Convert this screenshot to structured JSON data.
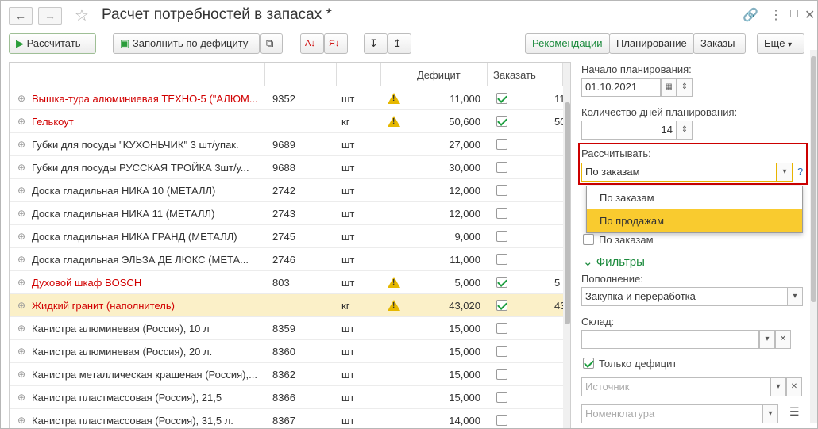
{
  "window": {
    "title": "Расчет потребностей в запасах *"
  },
  "toolbar": {
    "calc": "Рассчитать",
    "fill": "Заполнить по дефициту",
    "rec": "Рекомендации",
    "plan": "Планирование",
    "orders": "Заказы",
    "more": "Еще",
    "more_arrow": "▾"
  },
  "table": {
    "headers": {
      "deficit": "Дефицит",
      "order": "Заказать"
    },
    "rows": [
      {
        "name": "Вышка-тура алюминиевая ТЕХНО-5 (\"АЛЮМ...",
        "code": "9352",
        "unit": "шт",
        "warn": true,
        "deficit": "11,000",
        "checked": true,
        "extra": "11",
        "red": true
      },
      {
        "name": "Гелькоут",
        "code": "",
        "unit": "кг",
        "warn": true,
        "deficit": "50,600",
        "checked": true,
        "extra": "50",
        "red": true
      },
      {
        "name": "Губки для посуды \"КУХОНЬЧИК\" 3 шт/упак.",
        "code": "9689",
        "unit": "шт",
        "warn": false,
        "deficit": "27,000",
        "checked": false,
        "extra": "",
        "red": false
      },
      {
        "name": "Губки для посуды РУССКАЯ ТРОЙКА 3шт/у...",
        "code": "9688",
        "unit": "шт",
        "warn": false,
        "deficit": "30,000",
        "checked": false,
        "extra": "",
        "red": false
      },
      {
        "name": "Доска гладильная  НИКА 10 (МЕТАЛЛ)",
        "code": "2742",
        "unit": "шт",
        "warn": false,
        "deficit": "12,000",
        "checked": false,
        "extra": "",
        "red": false
      },
      {
        "name": "Доска гладильная  НИКА 11 (МЕТАЛЛ)",
        "code": "2743",
        "unit": "шт",
        "warn": false,
        "deficit": "12,000",
        "checked": false,
        "extra": "",
        "red": false
      },
      {
        "name": "Доска гладильная  НИКА ГРАНД (МЕТАЛЛ)",
        "code": "2745",
        "unit": "шт",
        "warn": false,
        "deficit": "9,000",
        "checked": false,
        "extra": "",
        "red": false
      },
      {
        "name": "Доска гладильная  ЭЛЬЗА ДЕ ЛЮКС (МЕТА...",
        "code": "2746",
        "unit": "шт",
        "warn": false,
        "deficit": "11,000",
        "checked": false,
        "extra": "",
        "red": false
      },
      {
        "name": "Духовой шкаф                        BOSCH",
        "code": "803",
        "unit": "шт",
        "warn": true,
        "deficit": "5,000",
        "checked": true,
        "extra": "5",
        "red": true
      },
      {
        "name": "Жидкий гранит (наполнитель)",
        "code": "",
        "unit": "кг",
        "warn": true,
        "deficit": "43,020",
        "checked": true,
        "extra": "43",
        "red": true,
        "selected": true
      },
      {
        "name": "Канистра алюминевая (Россия), 10 л",
        "code": "8359",
        "unit": "шт",
        "warn": false,
        "deficit": "15,000",
        "checked": false,
        "extra": "",
        "red": false
      },
      {
        "name": "Канистра алюминевая (Россия), 20 л.",
        "code": "8360",
        "unit": "шт",
        "warn": false,
        "deficit": "15,000",
        "checked": false,
        "extra": "",
        "red": false
      },
      {
        "name": "Канистра металлическая крашеная (Россия),...",
        "code": "8362",
        "unit": "шт",
        "warn": false,
        "deficit": "15,000",
        "checked": false,
        "extra": "",
        "red": false
      },
      {
        "name": "Канистра пластмассовая (Россия), 21,5",
        "code": "8366",
        "unit": "шт",
        "warn": false,
        "deficit": "15,000",
        "checked": false,
        "extra": "",
        "red": false
      },
      {
        "name": "Канистра пластмассовая (Россия), 31,5 л.",
        "code": "8367",
        "unit": "шт",
        "warn": false,
        "deficit": "14,000",
        "checked": false,
        "extra": "",
        "red": false
      }
    ]
  },
  "panel": {
    "start_label": "Начало планирования:",
    "start_value": "01.10.2021",
    "days_label": "Количество дней планирования:",
    "days_value": "14",
    "calc_label": "Рассчитывать:",
    "calc_value": "По заказам",
    "options": [
      "По заказам",
      "По продажам"
    ],
    "orders_check": "По заказам",
    "filters": "Фильтры",
    "replenish_label": "Пополнение:",
    "replenish_value": "Закупка и переработка",
    "warehouse_label": "Склад:",
    "deficit_only": "Только дефицит",
    "source_ph": "Источник",
    "nomen_ph": "Номенклатура",
    "help": "?"
  }
}
